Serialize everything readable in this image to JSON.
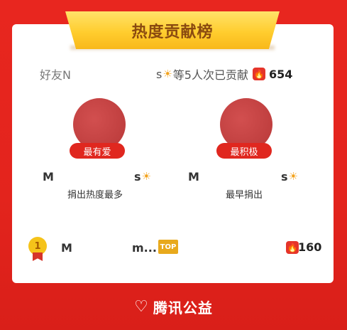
{
  "header": {
    "title": "热度贡献榜"
  },
  "summary": {
    "prefix": "好友N",
    "suffix_char": "s",
    "text": "等5人次已贡献",
    "count": "654"
  },
  "heroes": [
    {
      "tag": "最有爱",
      "name_start": "M",
      "name_end": "s",
      "subtitle": "捐出热度最多"
    },
    {
      "tag": "最积极",
      "name_start": "M",
      "name_end": "s",
      "subtitle": "最早捐出"
    }
  ],
  "ranking": [
    {
      "rank": "1",
      "name_start": "M",
      "name_end": "m...",
      "badge": "TOP",
      "score": "160"
    }
  ],
  "footer": {
    "brand": "腾讯公益"
  },
  "colors": {
    "primary": "#e3241d",
    "gold": "#ffcd2e",
    "avatar": "#c44444"
  },
  "icons": [
    "sun-icon",
    "fire-icon",
    "medal-icon",
    "heart-icon"
  ]
}
